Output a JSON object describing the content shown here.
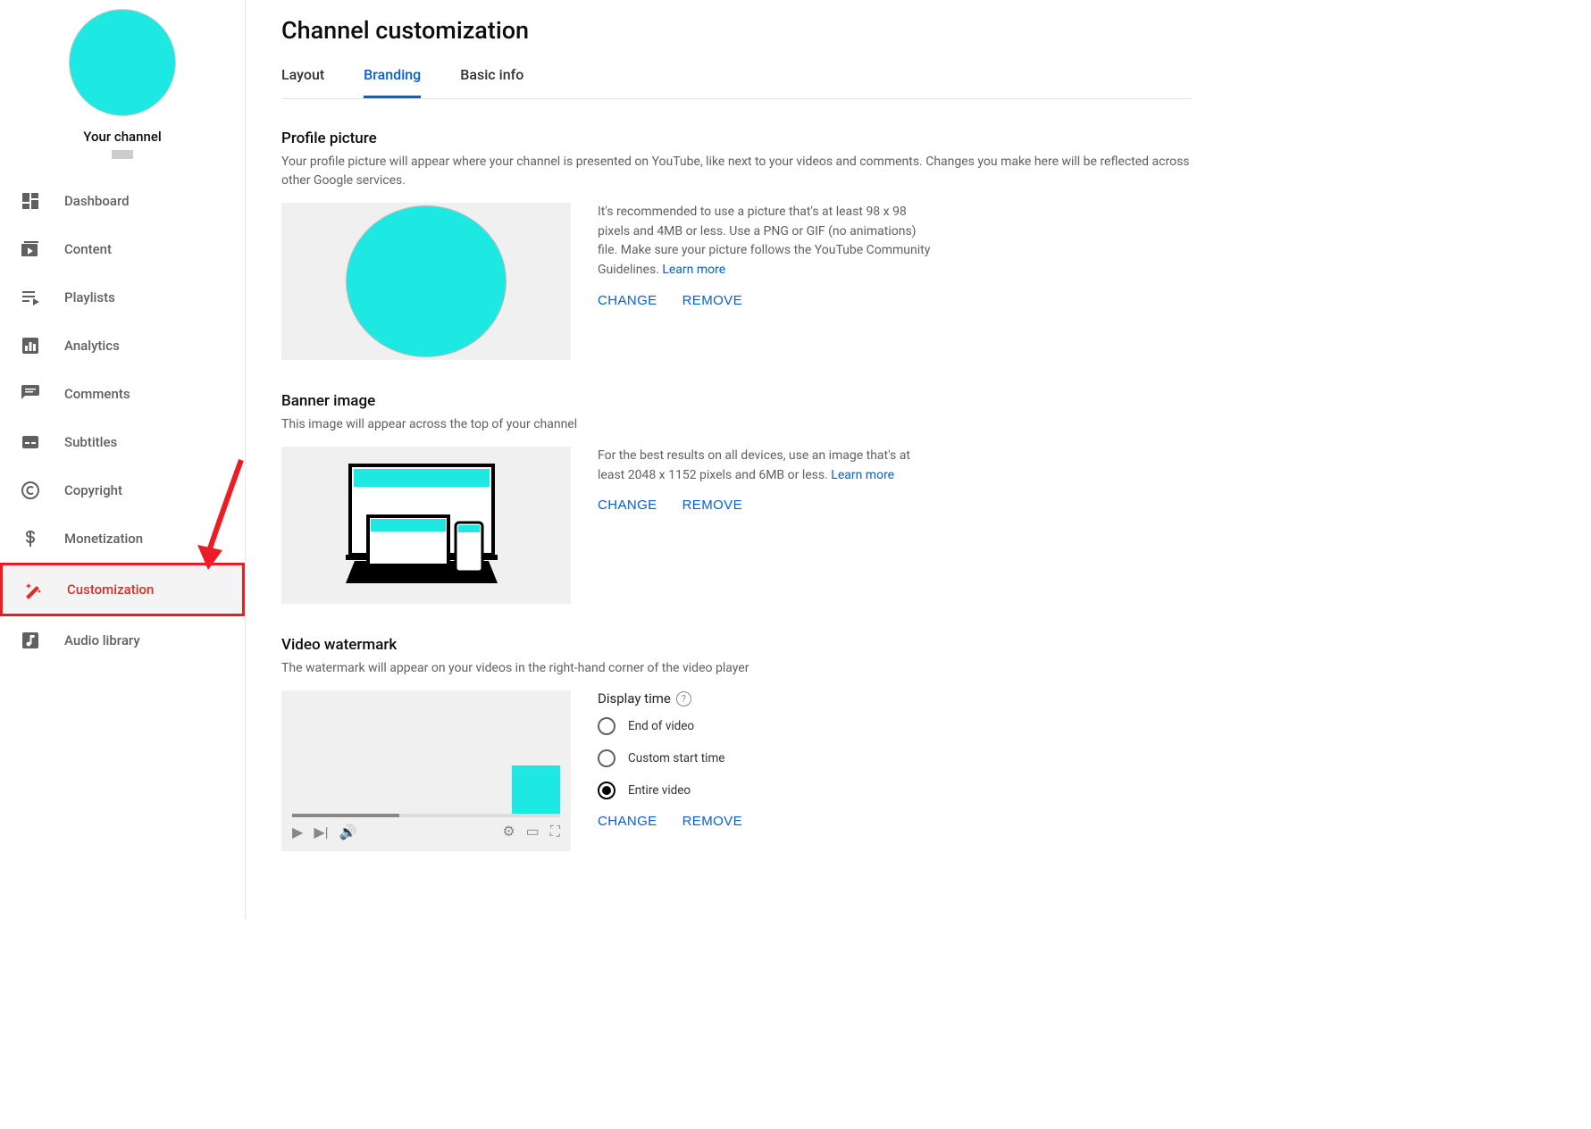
{
  "sidebar": {
    "your_channel": "Your channel",
    "items": [
      {
        "label": "Dashboard"
      },
      {
        "label": "Content"
      },
      {
        "label": "Playlists"
      },
      {
        "label": "Analytics"
      },
      {
        "label": "Comments"
      },
      {
        "label": "Subtitles"
      },
      {
        "label": "Copyright"
      },
      {
        "label": "Monetization"
      },
      {
        "label": "Customization"
      },
      {
        "label": "Audio library"
      }
    ]
  },
  "page": {
    "title": "Channel customization",
    "tabs": {
      "layout": "Layout",
      "branding": "Branding",
      "basic": "Basic info"
    }
  },
  "profile": {
    "title": "Profile picture",
    "desc": "Your profile picture will appear where your channel is presented on YouTube, like next to your videos and comments. Changes you make here will be reflected across other Google services.",
    "reco": "It's recommended to use a picture that's at least 98 x 98 pixels and 4MB or less. Use a PNG or GIF (no animations) file. Make sure your picture follows the YouTube Community Guidelines. ",
    "learn_more": "Learn more",
    "change": "CHANGE",
    "remove": "REMOVE"
  },
  "banner": {
    "title": "Banner image",
    "desc": "This image will appear across the top of your channel",
    "reco": "For the best results on all devices, use an image that's at least 2048 x 1152 pixels and 6MB or less. ",
    "learn_more": "Learn more",
    "change": "CHANGE",
    "remove": "REMOVE"
  },
  "watermark": {
    "title": "Video watermark",
    "desc": "The watermark will appear on your videos in the right-hand corner of the video player",
    "display_time": "Display time",
    "options": {
      "end": "End of video",
      "custom": "Custom start time",
      "entire": "Entire video"
    },
    "change": "CHANGE",
    "remove": "REMOVE"
  }
}
